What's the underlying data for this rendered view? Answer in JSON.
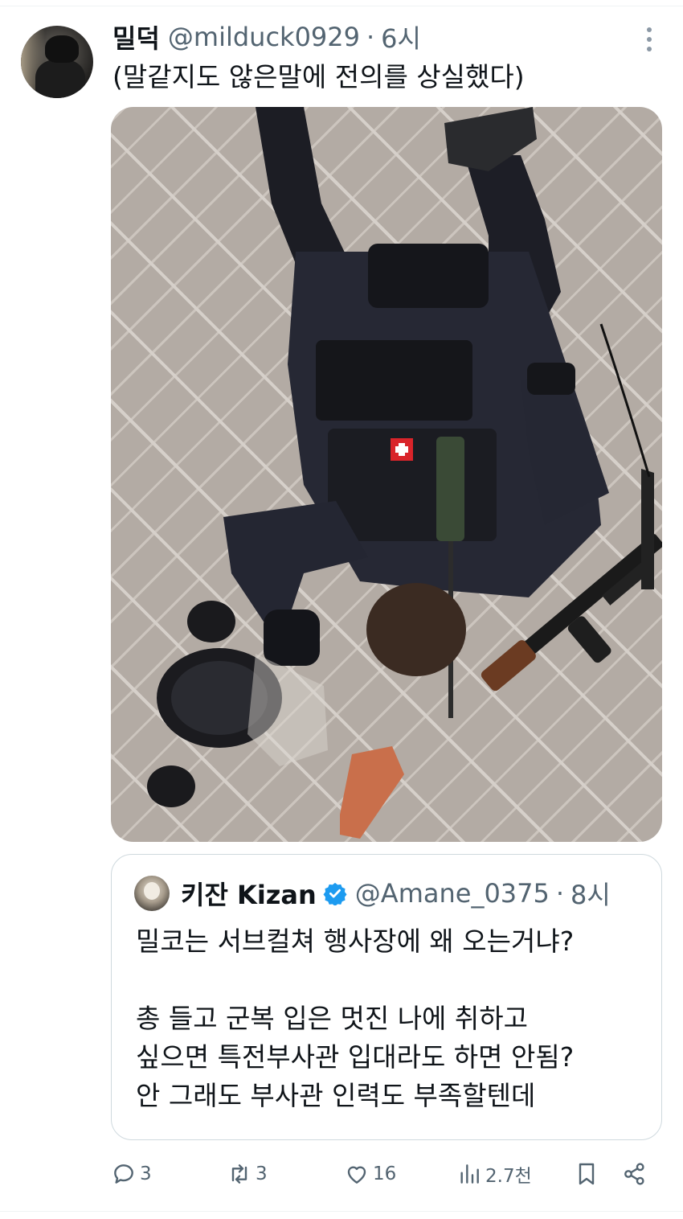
{
  "tweet": {
    "display_name": "밀덕",
    "handle": "@milduck0929",
    "separator": "·",
    "time": "6시",
    "text": "(말같지도 않은말에 전의를 상실했다)",
    "avatar_icon": "profile-avatar",
    "more_icon": "more-vertical-icon",
    "media_icon": "photo-image"
  },
  "quoted_tweet": {
    "display_name": "키잔 Kizan",
    "verified_color": "#1d9bf0",
    "handle": "@Amane_0375",
    "separator": "·",
    "time": "8시",
    "lines": [
      "밀코는 서브컬쳐 행사장에 왜 오는거냐?",
      "",
      "총 들고 군복 입은 멋진 나에 취하고",
      "싶으면 특전부사관 입대라도 하면 안됨?",
      "안 그래도 부사관 인력도 부족할텐데"
    ]
  },
  "actions": {
    "reply_count": "3",
    "retweet_count": "3",
    "like_count": "16",
    "views_count": "2.7천",
    "icons": [
      "reply-icon",
      "retweet-icon",
      "like-icon",
      "views-icon",
      "bookmark-icon",
      "share-icon"
    ]
  },
  "colors": {
    "text_primary": "#0f1419",
    "text_secondary": "#536471",
    "border": "#cfd9de",
    "accent": "#1d9bf0"
  }
}
